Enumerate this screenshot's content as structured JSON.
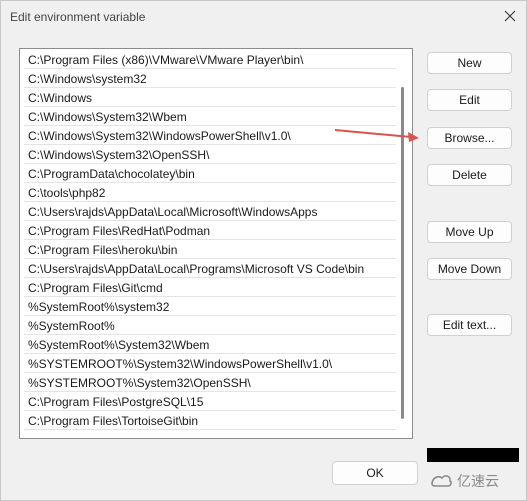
{
  "window": {
    "title": "Edit environment variable",
    "close_glyph": "✕"
  },
  "paths": [
    "C:\\Program Files (x86)\\VMware\\VMware Player\\bin\\",
    "C:\\Windows\\system32",
    "C:\\Windows",
    "C:\\Windows\\System32\\Wbem",
    "C:\\Windows\\System32\\WindowsPowerShell\\v1.0\\",
    "C:\\Windows\\System32\\OpenSSH\\",
    "C:\\ProgramData\\chocolatey\\bin",
    "C:\\tools\\php82",
    "C:\\Users\\rajds\\AppData\\Local\\Microsoft\\WindowsApps",
    "C:\\Program Files\\RedHat\\Podman",
    "C:\\Program Files\\heroku\\bin",
    "C:\\Users\\rajds\\AppData\\Local\\Programs\\Microsoft VS Code\\bin",
    "C:\\Program Files\\Git\\cmd",
    "%SystemRoot%\\system32",
    "%SystemRoot%",
    "%SystemRoot%\\System32\\Wbem",
    "%SYSTEMROOT%\\System32\\WindowsPowerShell\\v1.0\\",
    "%SYSTEMROOT%\\System32\\OpenSSH\\",
    "C:\\Program Files\\PostgreSQL\\15",
    "C:\\Program Files\\TortoiseGit\\bin"
  ],
  "buttons": {
    "new": "New",
    "edit": "Edit",
    "browse": "Browse...",
    "delete": "Delete",
    "move_up": "Move Up",
    "move_down": "Move Down",
    "edit_text": "Edit text...",
    "ok": "OK"
  },
  "watermark": {
    "text": "亿速云"
  },
  "colors": {
    "arrow": "#d9534f",
    "watermark": "#8a8a8a"
  }
}
